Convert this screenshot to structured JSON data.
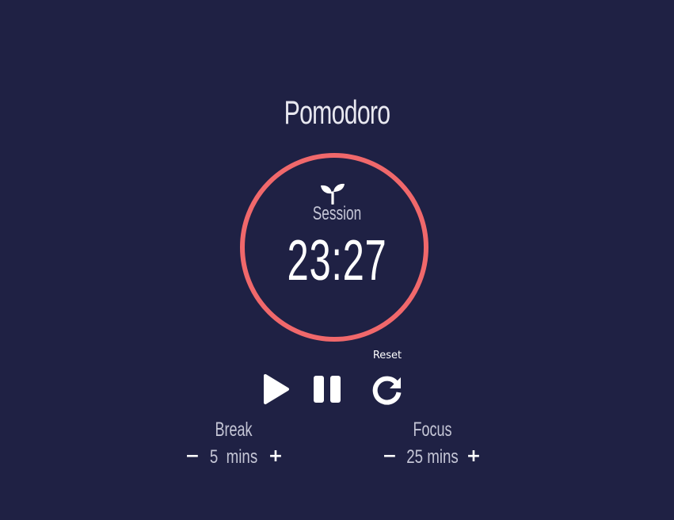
{
  "app": {
    "title": "Pomodoro",
    "accent_color": "#f0686b",
    "background_color": "#1f2144"
  },
  "timer": {
    "mode_icon": "sprout-icon",
    "mode_label": "Session",
    "time": "23:27"
  },
  "controls": {
    "play_icon": "play-icon",
    "pause_icon": "pause-icon",
    "reset_icon": "reset-icon",
    "reset_tooltip": "Reset"
  },
  "settings": {
    "break": {
      "label": "Break",
      "value": "5",
      "unit": "mins",
      "decrement": "−",
      "increment": "+"
    },
    "focus": {
      "label": "Focus",
      "value": "25",
      "unit": "mins",
      "decrement": "−",
      "increment": "+"
    }
  }
}
